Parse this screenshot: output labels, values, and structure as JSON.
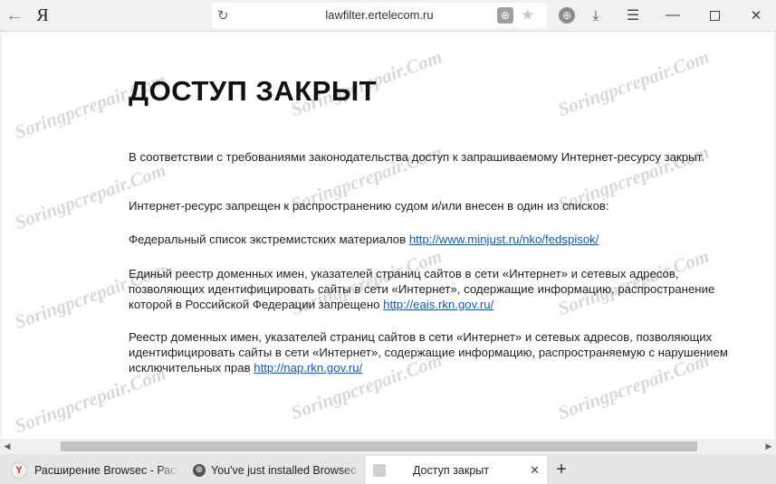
{
  "browser": {
    "logo": "Я",
    "url": "lawfilter.ertelecom.ru",
    "icons": {
      "back": "back-arrow-icon",
      "reload": "reload-icon",
      "protect": "vpn-globe-icon",
      "bookmark": "star-icon",
      "extension": "browsec-globe-icon",
      "downloads": "download-icon",
      "menu": "hamburger-icon",
      "minimize": "minimize-icon",
      "maximize": "maximize-icon",
      "close": "close-icon"
    }
  },
  "page": {
    "heading": "ДОСТУП ЗАКРЫТ",
    "intro": "В соответствии с требованиями законодательства доступ к запрашиваемому Интернет-ресурсу закрыт.",
    "reason": "Интернет-ресурс запрещен к распространению судом и/или внесен в один из списков:",
    "lists": [
      {
        "text": "Федеральный список экстремистских материалов ",
        "link": "http://www.minjust.ru/nko/fedspisok/"
      },
      {
        "text": "Единый реестр доменных имен, указателей страниц сайтов в сети «Интернет» и сетевых адресов, позволяющих идентифицировать сайты в сети «Интернет», содержащие информацию, распространение которой в Российской Федерации запрещено ",
        "link": "http://eais.rkn.gov.ru/"
      },
      {
        "text": "Реестр доменных имен, указателей страниц сайтов в сети «Интернет» и сетевых адресов, позволяющих идентифицировать сайты в сети «Интернет», содержащие информацию, распространяемую с нарушением исключительных прав ",
        "link": "http://nap.rkn.gov.ru/"
      }
    ]
  },
  "watermark": "Soringpcrepair.Com",
  "tabs": [
    {
      "title": "Расширение Browsec - Расширения",
      "favicon": "yandex-icon",
      "active": false
    },
    {
      "title": "You've just installed Browsec",
      "favicon": "globe-icon",
      "active": false
    },
    {
      "title": "Доступ закрыт",
      "favicon": "blank-page-icon",
      "active": true
    }
  ],
  "tabbar": {
    "close_glyph": "✕",
    "new_tab_glyph": "+"
  }
}
